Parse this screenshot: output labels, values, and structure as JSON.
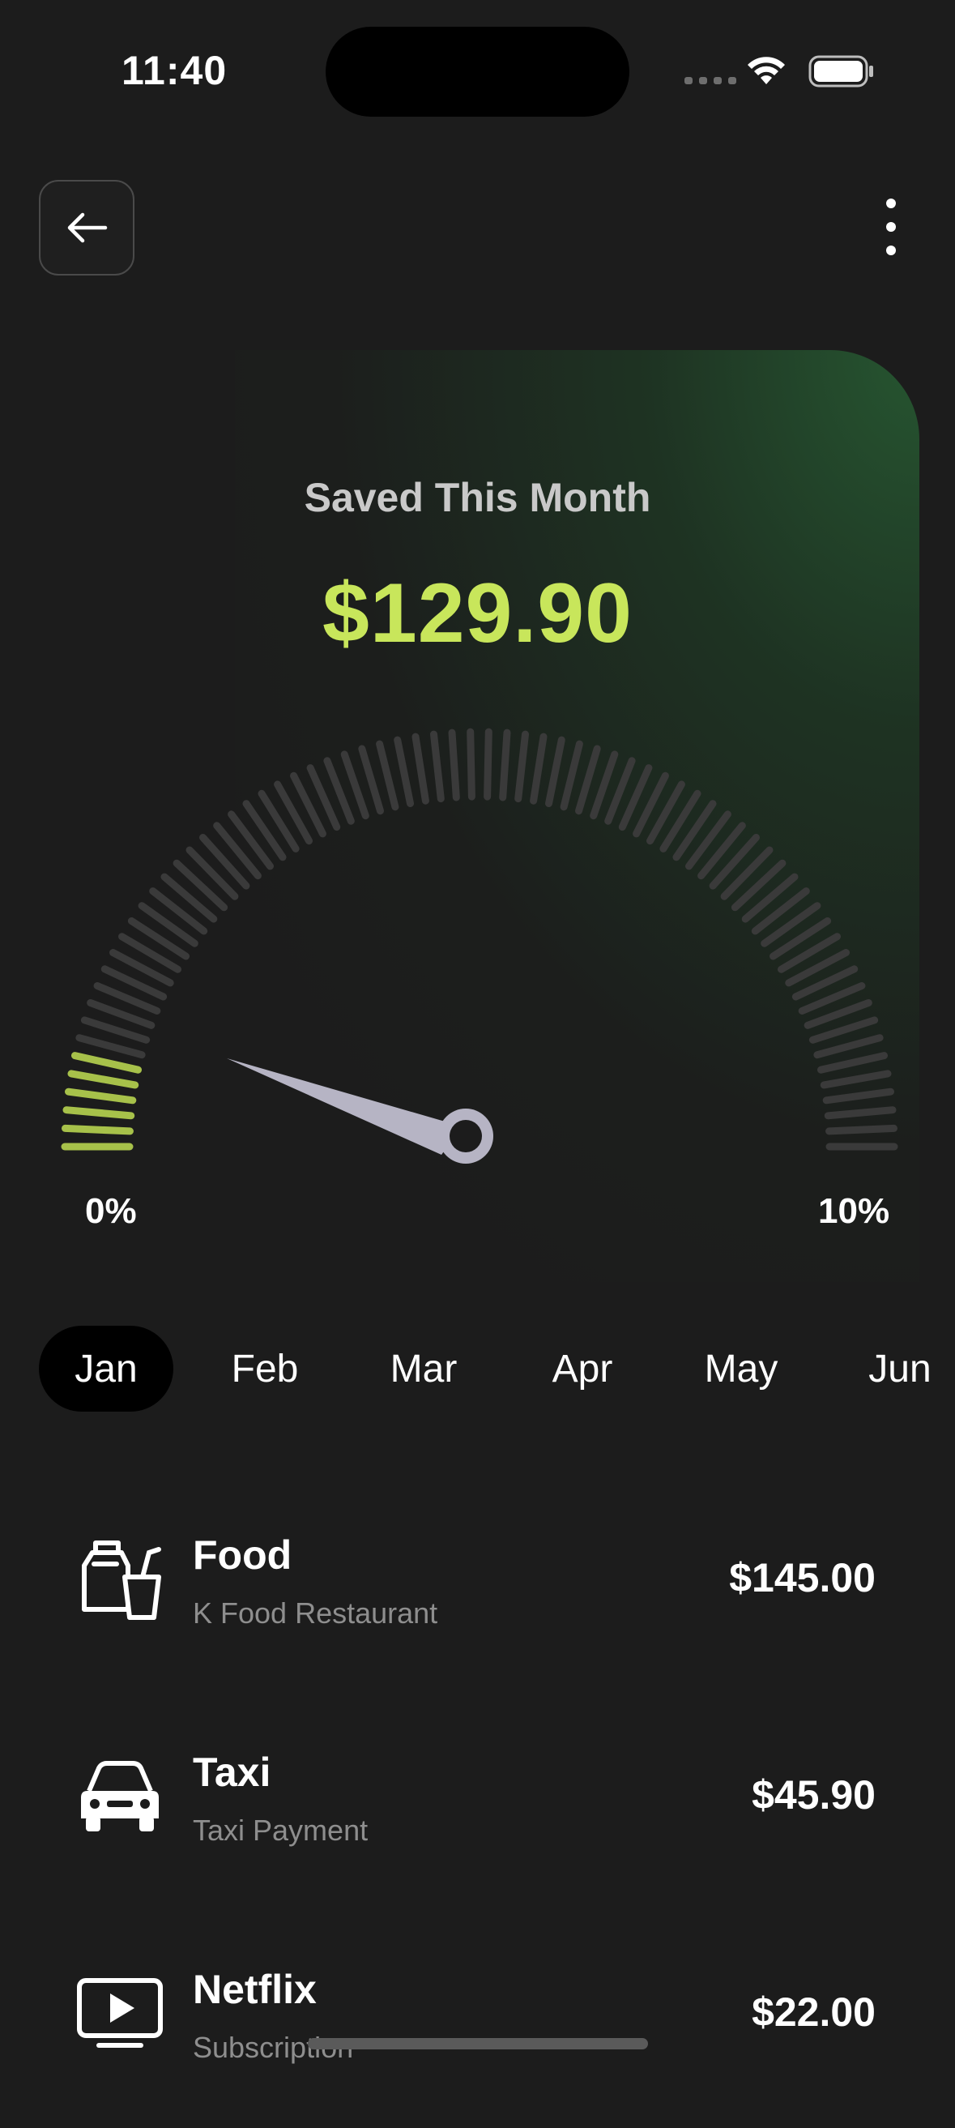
{
  "status_bar": {
    "time": "11:40"
  },
  "header": {
    "back_icon": "arrow-left-icon",
    "more_icon": "more-vertical-icon"
  },
  "summary": {
    "label": "Saved This Month",
    "amount": "$129.90"
  },
  "gauge": {
    "min_label": "0%",
    "max_label": "10%",
    "progress": 0.08,
    "active_color": "#a7c14a",
    "inactive_color": "#3a3a3a"
  },
  "months": {
    "items": [
      "Jan",
      "Feb",
      "Mar",
      "Apr",
      "May",
      "Jun"
    ],
    "selected": "Jan"
  },
  "transactions": [
    {
      "title": "Food",
      "subtitle": "K Food Restaurant",
      "amount": "$145.00",
      "icon": "food-drink-icon"
    },
    {
      "title": "Taxi",
      "subtitle": "Taxi Payment",
      "amount": "$45.90",
      "icon": "car-icon"
    },
    {
      "title": "Netflix",
      "subtitle": "Subscription",
      "amount": "$22.00",
      "icon": "play-screen-icon"
    }
  ],
  "colors": {
    "accent": "#c8e65b",
    "background": "#1c1c1c"
  }
}
